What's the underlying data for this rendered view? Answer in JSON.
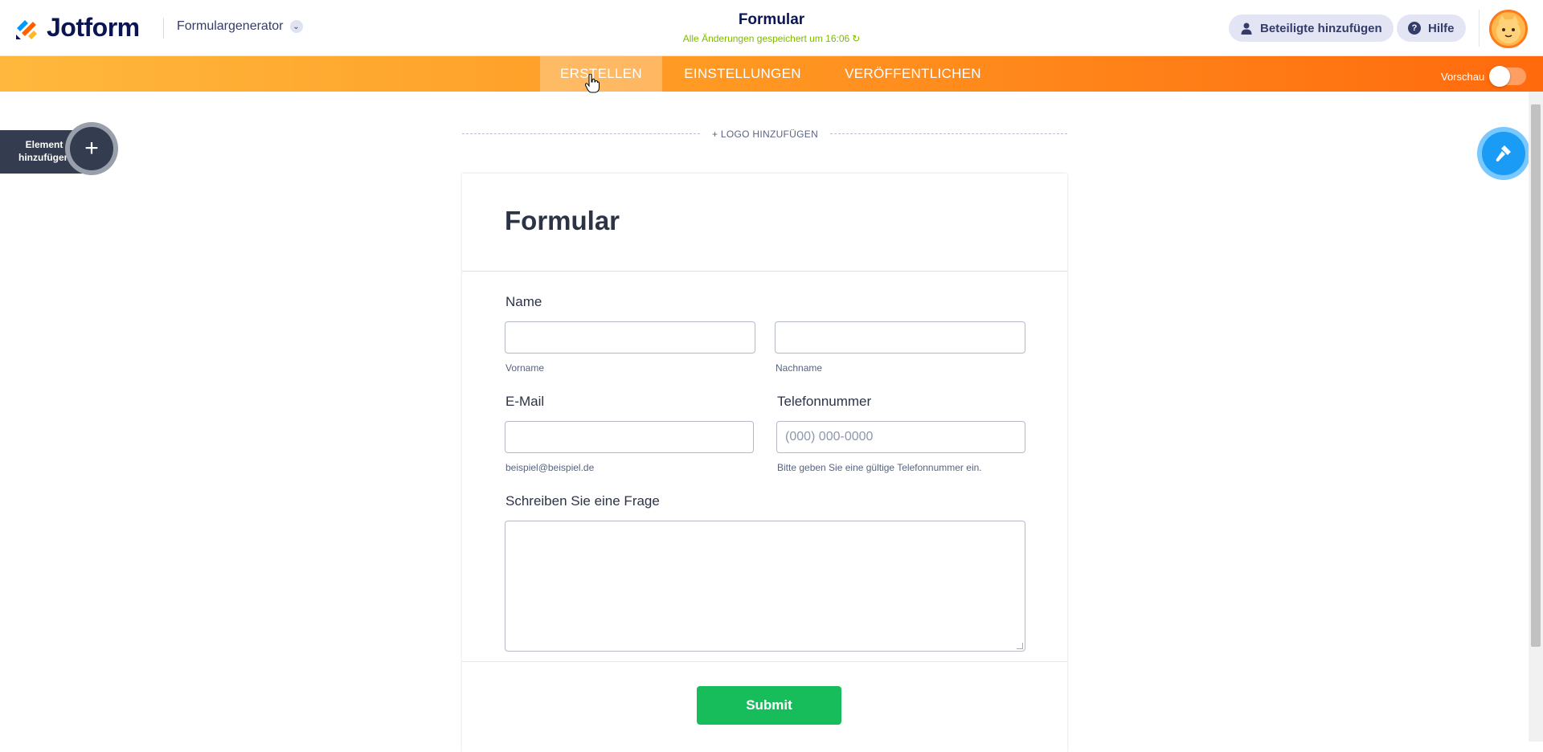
{
  "header": {
    "brand": "Jotform",
    "app_name": "Formulargenerator",
    "form_title": "Formular",
    "saved_status": "Alle Änderungen gespeichert um 16:06",
    "invite_label": "Beteiligte hinzufügen",
    "help_label": "Hilfe"
  },
  "nav": {
    "tabs": [
      {
        "label": "ERSTELLEN",
        "active": true
      },
      {
        "label": "EINSTELLUNGEN",
        "active": false
      },
      {
        "label": "VERÖFFENTLICHEN",
        "active": false
      }
    ],
    "preview_label": "Vorschau",
    "preview_on": false
  },
  "builder": {
    "add_element_label": "Element hinzufügen",
    "add_logo_label": "+ LOGO HINZUFÜGEN"
  },
  "form": {
    "title": "Formular",
    "name_label": "Name",
    "first_name_sub": "Vorname",
    "last_name_sub": "Nachname",
    "email_label": "E-Mail",
    "email_sub": "beispiel@beispiel.de",
    "phone_label": "Telefonnummer",
    "phone_placeholder": "(000) 000-0000",
    "phone_sub": "Bitte geben Sie eine gültige Telefonnummer ein.",
    "question_label": "Schreiben Sie eine Frage",
    "submit_label": "Submit"
  },
  "colors": {
    "brand_navy": "#0a1551",
    "nav_orange_start": "#ffb83d",
    "nav_orange_end": "#ff6a0d",
    "saved_green": "#7fba00",
    "submit_green": "#18bd5b",
    "paint_blue": "#1a9bf5"
  },
  "icons": [
    "jotform-logo-icon",
    "chevron-down-icon",
    "refresh-icon",
    "user-icon",
    "help-icon",
    "avatar-icon",
    "plus-icon",
    "paint-roller-icon",
    "hand-cursor-icon",
    "resize-handle-icon"
  ]
}
